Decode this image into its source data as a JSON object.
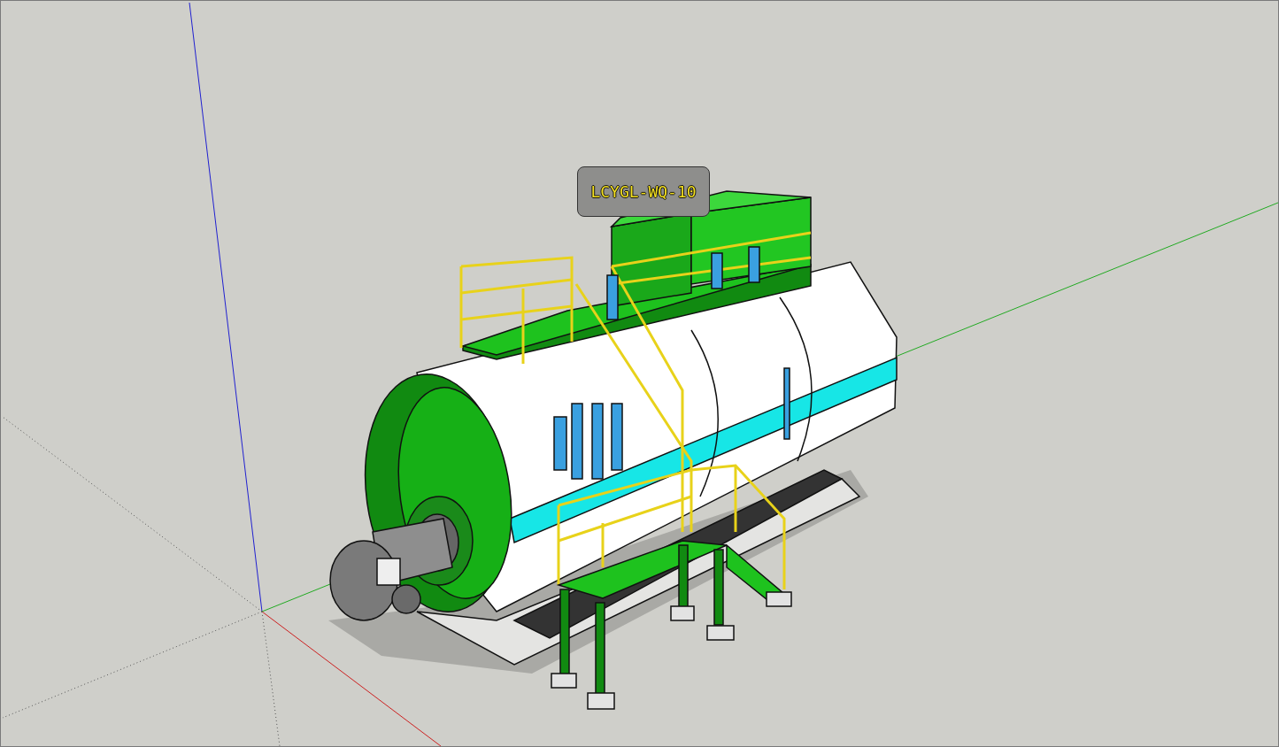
{
  "viewport": {
    "label": {
      "text": "LCYGL-WQ-10"
    }
  }
}
